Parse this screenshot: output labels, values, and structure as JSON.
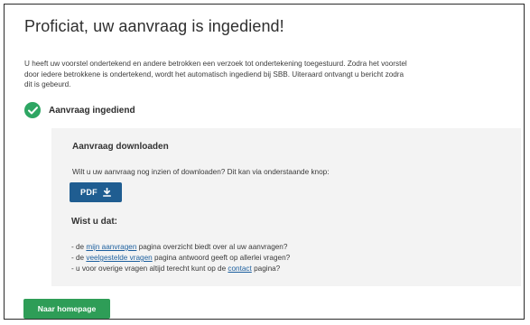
{
  "page": {
    "title": "Proficiat, uw aanvraag is ingediend!",
    "intro": "U heeft uw voorstel ondertekend en andere betrokken een verzoek tot ondertekening toegestuurd. Zodra het voorstel door iedere betrokkene is ondertekend, wordt het automatisch ingediend bij SBB. Uiteraard ontvangt u bericht zodra dit is gebeurd."
  },
  "status": {
    "label": "Aanvraag ingediend",
    "icon": "check-circle-icon",
    "color": "#2ea663"
  },
  "download": {
    "title": "Aanvraag downloaden",
    "text": "Wilt u uw aanvraag nog inzien of downloaden? Dit kan via onderstaande knop:",
    "button_label": "PDF",
    "button_icon": "download-icon",
    "button_color": "#1f5d91"
  },
  "wist": {
    "title": "Wist u dat:",
    "tips": [
      {
        "prefix": "- de ",
        "link": "mijn aanvragen",
        "suffix": " pagina overzicht biedt over al uw aanvragen?"
      },
      {
        "prefix": "- de ",
        "link": "veelgestelde vragen",
        "suffix": " pagina antwoord geeft op allerlei vragen?"
      },
      {
        "prefix": "- u voor overige vragen altijd terecht kunt op de ",
        "link": "contact",
        "suffix": " pagina?"
      }
    ]
  },
  "home_button": {
    "label": "Naar homepage",
    "color": "#2e9d57"
  }
}
